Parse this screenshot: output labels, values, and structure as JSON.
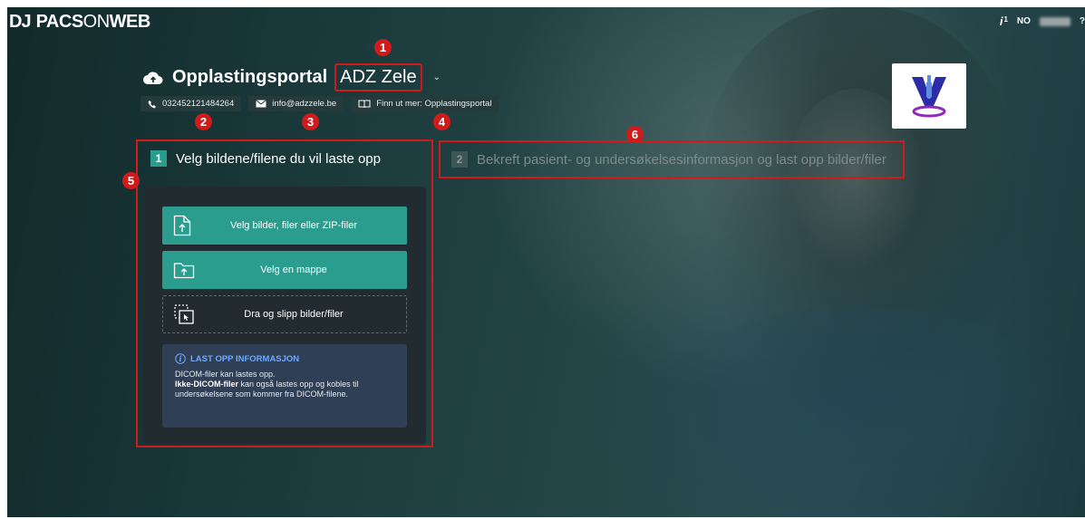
{
  "app": {
    "logo_mark": "DJ",
    "logo_bold": "PACS",
    "logo_thin": "ON",
    "logo_bold2": "WEB"
  },
  "topbar": {
    "info_icon": "i",
    "info_count": "1",
    "language": "NO",
    "help": "?"
  },
  "header": {
    "title": "Opplastingsportal",
    "portal_name": "ADZ Zele",
    "icon": "cloud-upload-icon"
  },
  "contacts": {
    "phone": "032452121484264",
    "email": "info@adzzele.be",
    "learn_more": "Finn ut mer: Opplastingsportal"
  },
  "badges": [
    "1",
    "2",
    "3",
    "4",
    "5",
    "6"
  ],
  "step1": {
    "number": "1",
    "title": "Velg bildene/filene du vil laste opp",
    "actions": {
      "select_files": "Velg bilder, filer eller ZIP-filer",
      "select_folder": "Velg en mappe",
      "drag_drop": "Dra og slipp bilder/filer"
    },
    "info": {
      "heading": "LAST OPP INFORMASJON",
      "line1": "DICOM-filer kan lastes opp.",
      "line2_bold": "Ikke-DICOM-filer",
      "line2_rest": " kan også lastes opp og kobles til undersøkelsene som kommer fra DICOM-filene."
    }
  },
  "step2": {
    "number": "2",
    "title": "Bekreft pasient- og undersøkelsesinformasjon og last opp bilder/filer"
  },
  "colors": {
    "accent": "#2a9d8f",
    "highlight": "#d11a1a",
    "info_link": "#6ea8ff"
  }
}
